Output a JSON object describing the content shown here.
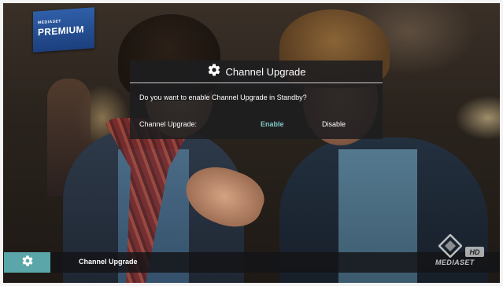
{
  "logo": {
    "small_text": "MEDIASET",
    "brand_text": "PREMIUM",
    "color": "#2f5fa8"
  },
  "dialog": {
    "icon": "gear-icon",
    "title": "Channel Upgrade",
    "question": "Do you want to enable Channel Upgrade in Standby?",
    "option_label": "Channel Upgrade:",
    "options": [
      {
        "label": "Enable",
        "selected": true
      },
      {
        "label": "Disable",
        "selected": false
      }
    ],
    "selected_color": "#7fc7c6"
  },
  "bottom_bar": {
    "icon": "gear-icon",
    "title": "Channel Upgrade",
    "accent_color": "#5aa6a8"
  },
  "watermark": {
    "channel_name": "MEDIASET",
    "hd_label": "HD"
  }
}
